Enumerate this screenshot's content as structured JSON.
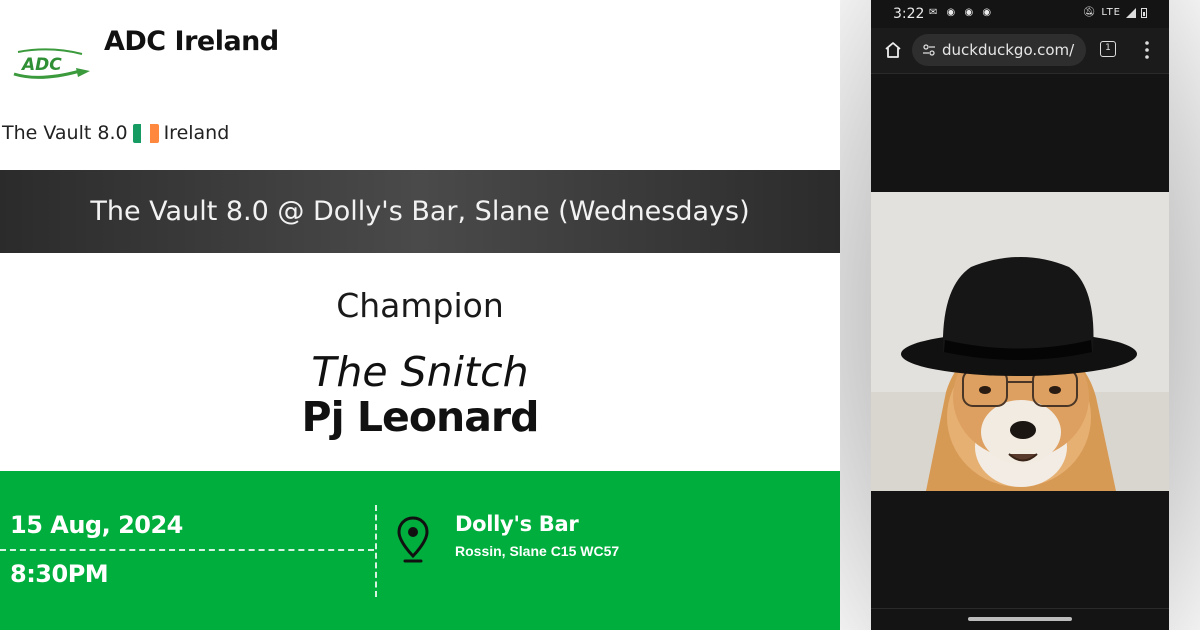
{
  "organization": {
    "name": "ADC Ireland",
    "logo_text": "ADC"
  },
  "subline": {
    "event": "The Vault 8.0",
    "country": "Ireland"
  },
  "event_banner": "The Vault 8.0 @ Dolly's Bar, Slane (Wednesdays)",
  "champion": {
    "label": "Champion",
    "nickname": "The Snitch",
    "name": "Pj Leonard"
  },
  "details": {
    "date": "15 Aug, 2024",
    "time": "8:30PM",
    "venue": "Dolly's Bar",
    "address": "Rossin, Slane C15 WC57"
  },
  "phone": {
    "status_time": "3:22",
    "status_network": "LTE",
    "url": "duckduckgo.com/",
    "tab_count": "1"
  },
  "icons": {
    "flag": "ireland-flag-icon",
    "pin": "location-pin-icon",
    "home": "home-icon",
    "menu": "more-vert-icon"
  },
  "colors": {
    "accent_green": "#00ae3d",
    "banner_dark": "#2b2b2b",
    "logo_green": "#3a9a3c",
    "flag_green": "#169b62",
    "flag_white": "#ffffff",
    "flag_orange": "#ff883e"
  }
}
